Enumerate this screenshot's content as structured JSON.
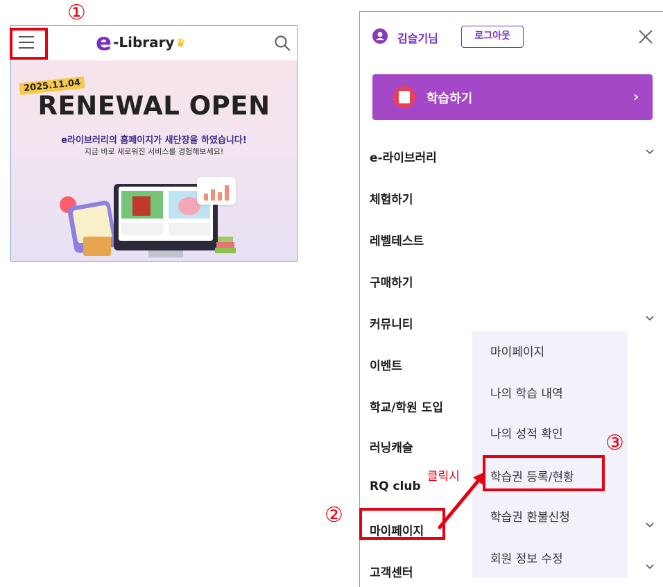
{
  "left_screen": {
    "logo": {
      "letter": "e",
      "text": "-Library",
      "crown": "♛"
    },
    "banner": {
      "date": "2025.11.04",
      "title": "RENEWAL OPEN",
      "subtitle": "e라이브러리의 홈페이지가 새단장을 하였습니다!",
      "description": "지금 바로 새로워진 서비스를 경험해보세요!"
    }
  },
  "menu": {
    "user_name": "김슬기님",
    "logout_label": "로그아웃",
    "study_button_label": "학습하기",
    "study_arrow": "›",
    "items": [
      {
        "label": "e-라이브러리"
      },
      {
        "label": "체험하기"
      },
      {
        "label": "레벨테스트"
      },
      {
        "label": "구매하기"
      },
      {
        "label": "커뮤니티"
      },
      {
        "label": "이벤트"
      },
      {
        "label": "학교/학원 도입"
      },
      {
        "label": "러닝캐슬"
      },
      {
        "label": "RQ club"
      },
      {
        "label": "마이페이지"
      },
      {
        "label": "고객센터"
      }
    ],
    "submenu": [
      {
        "label": "마이페이지"
      },
      {
        "label": "나의 학습 내역"
      },
      {
        "label": "나의 성적 확인"
      },
      {
        "label": "학습권 등록/현황"
      },
      {
        "label": "학습권 환불신청"
      },
      {
        "label": "회원 정보 수정"
      }
    ]
  },
  "annotations": {
    "step1": "①",
    "step2": "②",
    "step3": "③",
    "click_label": "클릭시"
  },
  "colors": {
    "brand_purple": "#7b2fbf",
    "study_button": "#a548c7",
    "annotation_red": "#e60012",
    "submenu_bg": "#f3f2fb"
  },
  "icons": [
    "hamburger-menu-icon",
    "search-icon",
    "user-icon",
    "close-icon",
    "notebook-icon",
    "chevron-down-icon"
  ]
}
